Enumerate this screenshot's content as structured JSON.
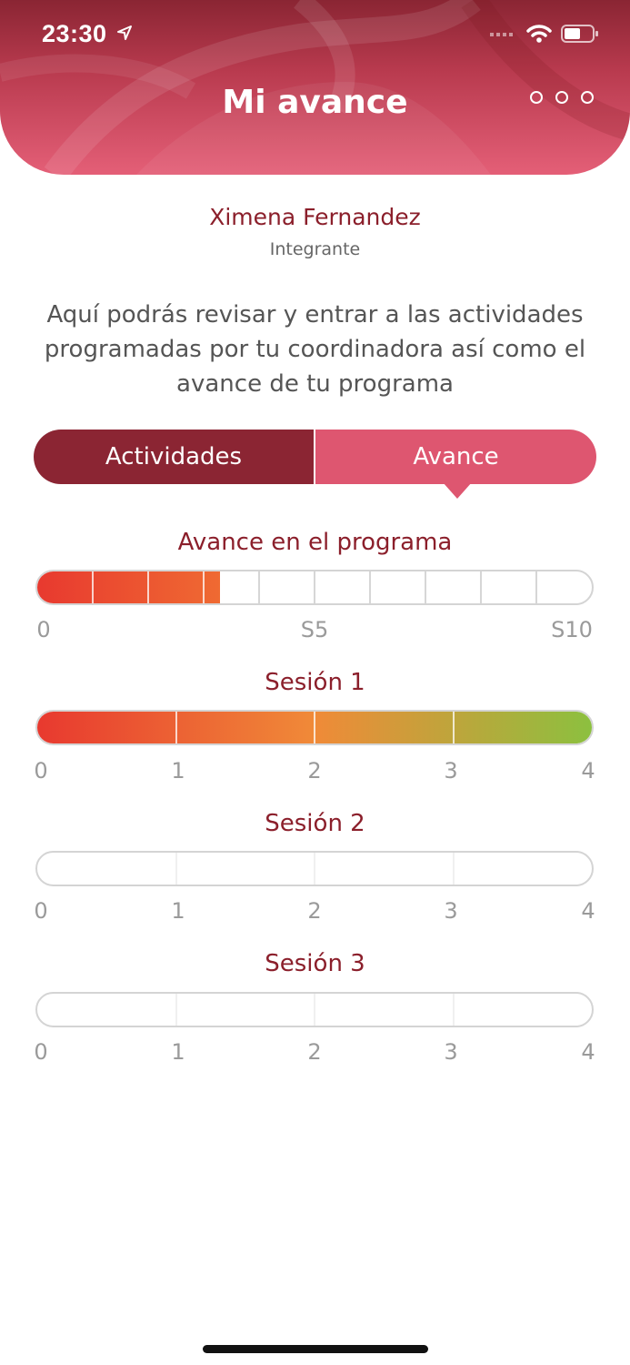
{
  "status_bar": {
    "time": "23:30"
  },
  "header": {
    "title": "Mi avance"
  },
  "profile": {
    "name": "Ximena Fernandez",
    "role": "Integrante"
  },
  "description": "Aquí podrás revisar y entrar a las actividades programadas por tu coordinadora así como el avance de tu programa",
  "tabs": [
    {
      "label": "Actividades",
      "selected": false
    },
    {
      "label": "Avance",
      "selected": true
    }
  ],
  "program": {
    "title": "Avance en el programa",
    "segments": 10,
    "progress_segments": 3.3,
    "ticks": [
      "0",
      "S5",
      "S10"
    ]
  },
  "sessions": [
    {
      "title": "Sesión 1",
      "max": 4,
      "value": 4,
      "ticks": [
        "0",
        "1",
        "2",
        "3",
        "4"
      ]
    },
    {
      "title": "Sesión 2",
      "max": 4,
      "value": 0,
      "ticks": [
        "0",
        "1",
        "2",
        "3",
        "4"
      ]
    },
    {
      "title": "Sesión 3",
      "max": 4,
      "value": 0,
      "ticks": [
        "0",
        "1",
        "2",
        "3",
        "4"
      ]
    }
  ],
  "colors": {
    "accent_dark": "#8b2533",
    "accent_light": "#de5670",
    "progress_start": "#e8392f",
    "progress_mid": "#f08a38",
    "progress_end": "#8cc03f"
  }
}
